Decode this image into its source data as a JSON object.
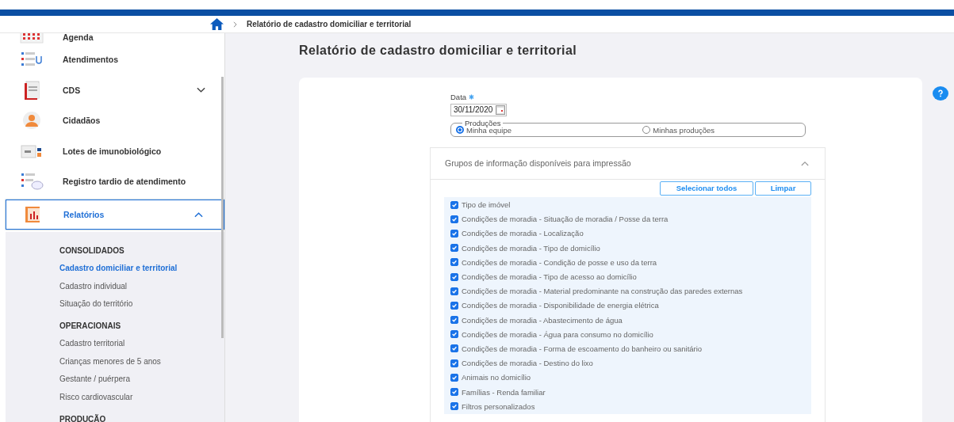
{
  "breadcrumb": {
    "current": "Relatório de cadastro domiciliar e territorial"
  },
  "sidebar": {
    "items": [
      {
        "label": "Agenda",
        "selected": false
      },
      {
        "label": "Atendimentos",
        "selected": false
      },
      {
        "label": "CDS",
        "selected": false,
        "expanded": false
      },
      {
        "label": "Cidadãos",
        "selected": false
      },
      {
        "label": "Lotes de imunobiológico",
        "selected": false
      },
      {
        "label": "Registro tardio de atendimento",
        "selected": false
      },
      {
        "label": "Relatórios",
        "selected": true,
        "expanded": true
      }
    ],
    "submenu": [
      {
        "kind": "heading",
        "label": "CONSOLIDADOS"
      },
      {
        "kind": "link",
        "label": "Cadastro domiciliar e territorial",
        "selected": true
      },
      {
        "kind": "link",
        "label": "Cadastro individual",
        "selected": false
      },
      {
        "kind": "link",
        "label": "Situação do território",
        "selected": false
      },
      {
        "kind": "heading",
        "label": "OPERACIONAIS"
      },
      {
        "kind": "link",
        "label": "Cadastro territorial",
        "selected": false
      },
      {
        "kind": "link",
        "label": "Crianças menores de 5 anos",
        "selected": false
      },
      {
        "kind": "link",
        "label": "Gestante / puérpera",
        "selected": false
      },
      {
        "kind": "link",
        "label": "Risco cardiovascular",
        "selected": false
      },
      {
        "kind": "heading",
        "label": "PRODUCÃO"
      }
    ]
  },
  "page": {
    "title": "Relatório de cadastro domiciliar e territorial",
    "date": {
      "label": "Data",
      "required": true,
      "value": "30/11/2020"
    },
    "productions": {
      "legend": "Produções",
      "options": [
        {
          "label": "Minha equipe",
          "selected": true
        },
        {
          "label": "Minhas produções",
          "selected": false
        }
      ]
    },
    "groups": {
      "title": "Grupos de informação disponíveis para impressão",
      "expanded": true,
      "buttons": [
        "Selecionar todos",
        "Limpar"
      ],
      "items": [
        {
          "label": "Tipo de imóvel",
          "checked": true
        },
        {
          "label": "Condições de moradia - Situação de moradia / Posse da terra",
          "checked": true
        },
        {
          "label": "Condições de moradia - Localização",
          "checked": true
        },
        {
          "label": "Condições de moradia - Tipo de domicílio",
          "checked": true
        },
        {
          "label": "Condições de moradia - Condição de posse e uso da terra",
          "checked": true
        },
        {
          "label": "Condições de moradia - Tipo de acesso ao domicílio",
          "checked": true
        },
        {
          "label": "Condições de moradia - Material predominante na construção das paredes externas",
          "checked": true
        },
        {
          "label": "Condições de moradia - Disponibilidade de energia elétrica",
          "checked": true
        },
        {
          "label": "Condições de moradia - Abastecimento de água",
          "checked": true
        },
        {
          "label": "Condições de moradia - Água para consumo no domicílio",
          "checked": true
        },
        {
          "label": "Condições de moradia - Forma de escoamento do banheiro ou sanitário",
          "checked": true
        },
        {
          "label": "Condições de moradia - Destino do lixo",
          "checked": true
        },
        {
          "label": "Animais no domicílio",
          "checked": true
        },
        {
          "label": "Famílias - Renda familiar",
          "checked": true
        },
        {
          "label": "Filtros personalizados",
          "checked": true
        }
      ]
    }
  }
}
